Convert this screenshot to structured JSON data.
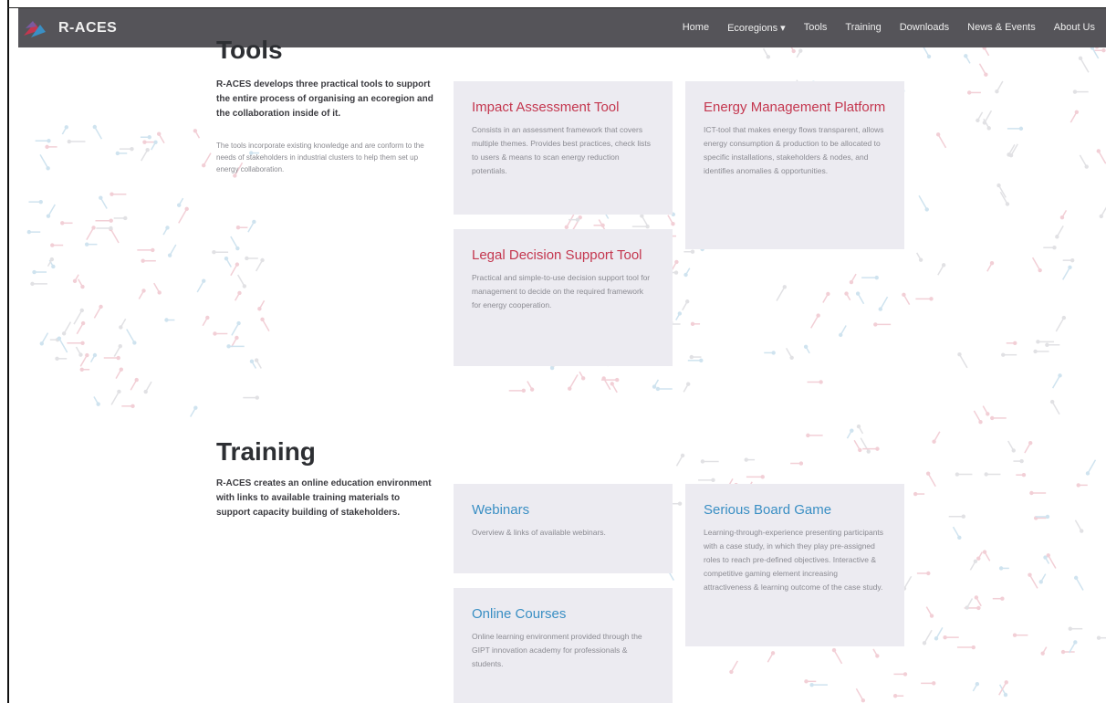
{
  "header": {
    "logo_text": "R-ACES",
    "nav": [
      "Home",
      "Ecoregions ▾",
      "Tools",
      "Training",
      "Downloads",
      "News & Events",
      "About Us"
    ]
  },
  "tools": {
    "title": "Tools",
    "intro": "R-ACES develops three practical tools to support the entire process of organising an ecoregion and the collaboration inside of it.",
    "sub": "The tools incorporate existing knowledge and are conform to the needs of stakeholders in industrial clusters to help them set up energy collaboration.",
    "cards": [
      {
        "title": "Impact Assessment Tool",
        "text": "Consists in an assessment framework that covers multiple themes. Provides best practices, check lists to users & means to scan energy reduction potentials."
      },
      {
        "title": "Energy Management Platform",
        "text": "ICT-tool that makes energy flows transparent, allows energy consumption & production to be allocated to specific installations, stakeholders & nodes, and identifies anomalies & opportunities."
      },
      {
        "title": "Legal Decision Support Tool",
        "text": "Practical and simple-to-use decision support tool for management to decide on the required framework for energy cooperation."
      }
    ]
  },
  "training": {
    "title": "Training",
    "intro": "R-ACES creates an online education environment with links to available training materials to support capacity building of stakeholders.",
    "cards": [
      {
        "title": "Webinars",
        "text": "Overview & links of available webinars."
      },
      {
        "title": "Serious Board Game",
        "text": "Learning-through-experience presenting participants with a case study, in which they play pre-assigned roles to reach pre-defined objectives. Interactive & competitive gaming element increasing attractiveness & learning outcome of the case study."
      },
      {
        "title": "Online Courses",
        "text": "Online learning environment provided through the GIPT innovation academy for professionals & students."
      }
    ]
  },
  "colors": {
    "nav_bg": "#555459",
    "card_bg": "#ecebf1",
    "tool_title": "#c4374f",
    "training_title": "#3a8fc4"
  }
}
